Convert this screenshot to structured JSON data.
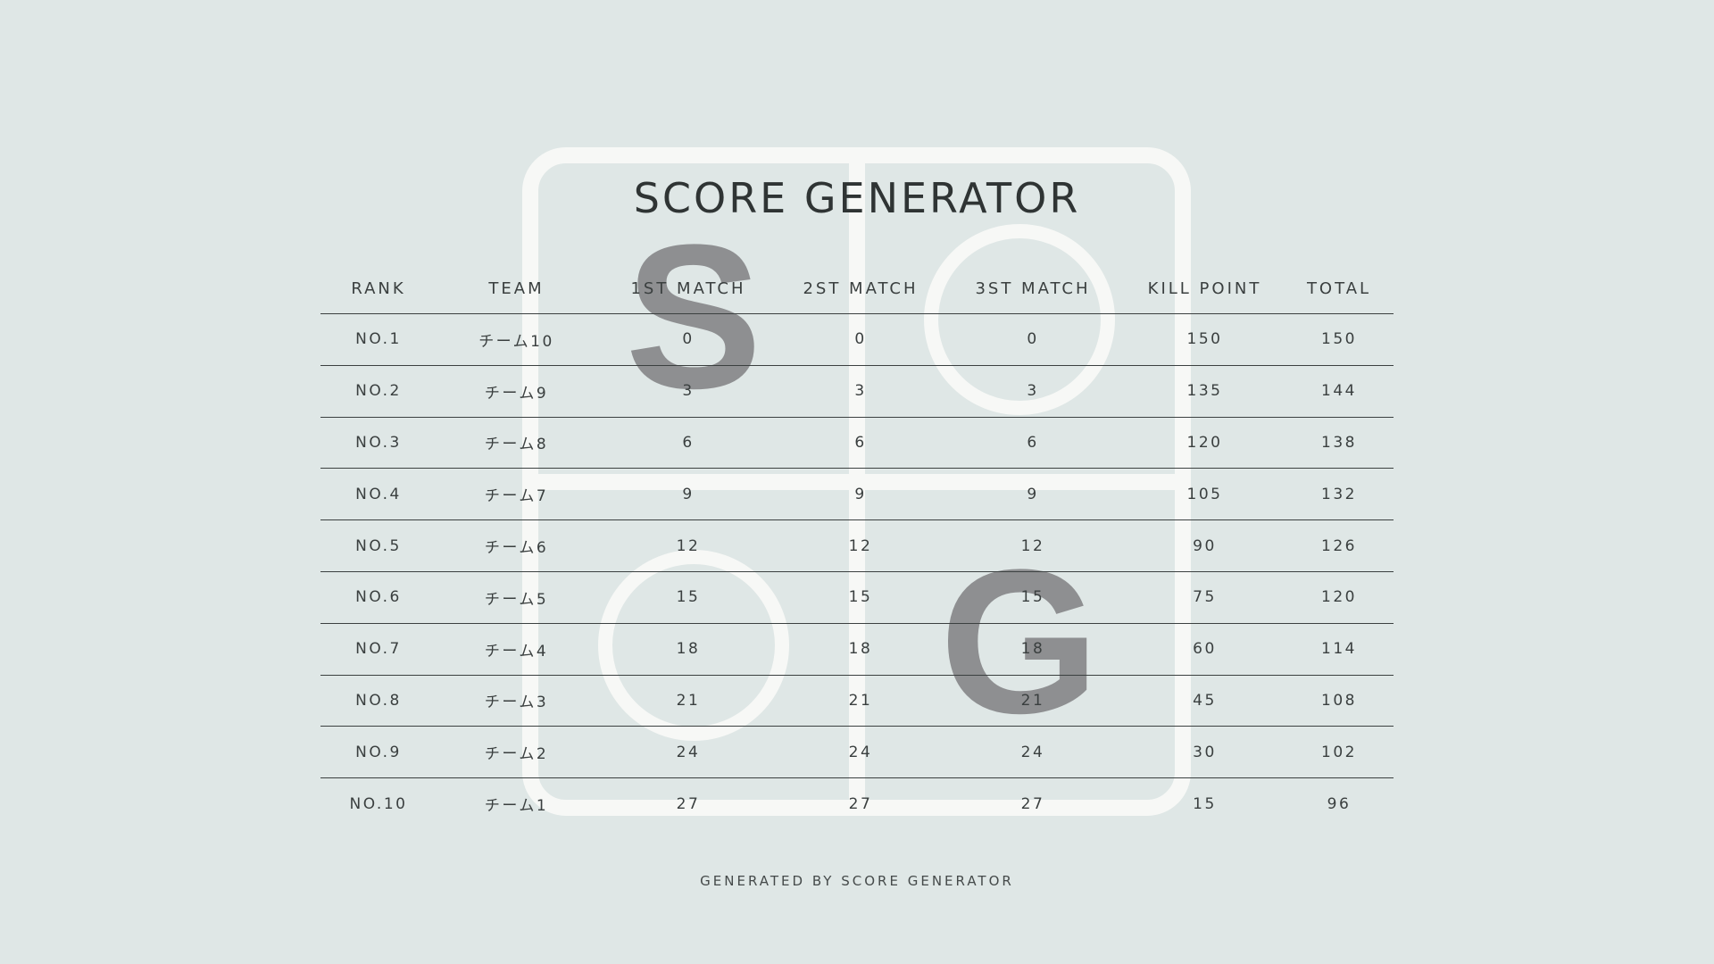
{
  "colors": {
    "background": "#dfe7e6",
    "text": "#3a3f3f",
    "rule": "#3b4040",
    "watermark_stroke": "#f7f8f6",
    "watermark_letter": "#8e8f91"
  },
  "logo": {
    "letter_s": "S",
    "letter_g": "G"
  },
  "title": "SCORE GENERATOR",
  "table": {
    "headers": [
      "RANK",
      "TEAM",
      "1ST MATCH",
      "2ST MATCH",
      "3ST MATCH",
      "KILL POINT",
      "TOTAL"
    ],
    "rows": [
      [
        "NO.1",
        "チーム10",
        "0",
        "0",
        "0",
        "150",
        "150"
      ],
      [
        "NO.2",
        "チーム9",
        "3",
        "3",
        "3",
        "135",
        "144"
      ],
      [
        "NO.3",
        "チーム8",
        "6",
        "6",
        "6",
        "120",
        "138"
      ],
      [
        "NO.4",
        "チーム7",
        "9",
        "9",
        "9",
        "105",
        "132"
      ],
      [
        "NO.5",
        "チーム6",
        "12",
        "12",
        "12",
        "90",
        "126"
      ],
      [
        "NO.6",
        "チーム5",
        "15",
        "15",
        "15",
        "75",
        "120"
      ],
      [
        "NO.7",
        "チーム4",
        "18",
        "18",
        "18",
        "60",
        "114"
      ],
      [
        "NO.8",
        "チーム3",
        "21",
        "21",
        "21",
        "45",
        "108"
      ],
      [
        "NO.9",
        "チーム2",
        "24",
        "24",
        "24",
        "30",
        "102"
      ],
      [
        "NO.10",
        "チーム1",
        "27",
        "27",
        "27",
        "15",
        "96"
      ]
    ]
  },
  "footer": "GENERATED BY SCORE GENERATOR"
}
